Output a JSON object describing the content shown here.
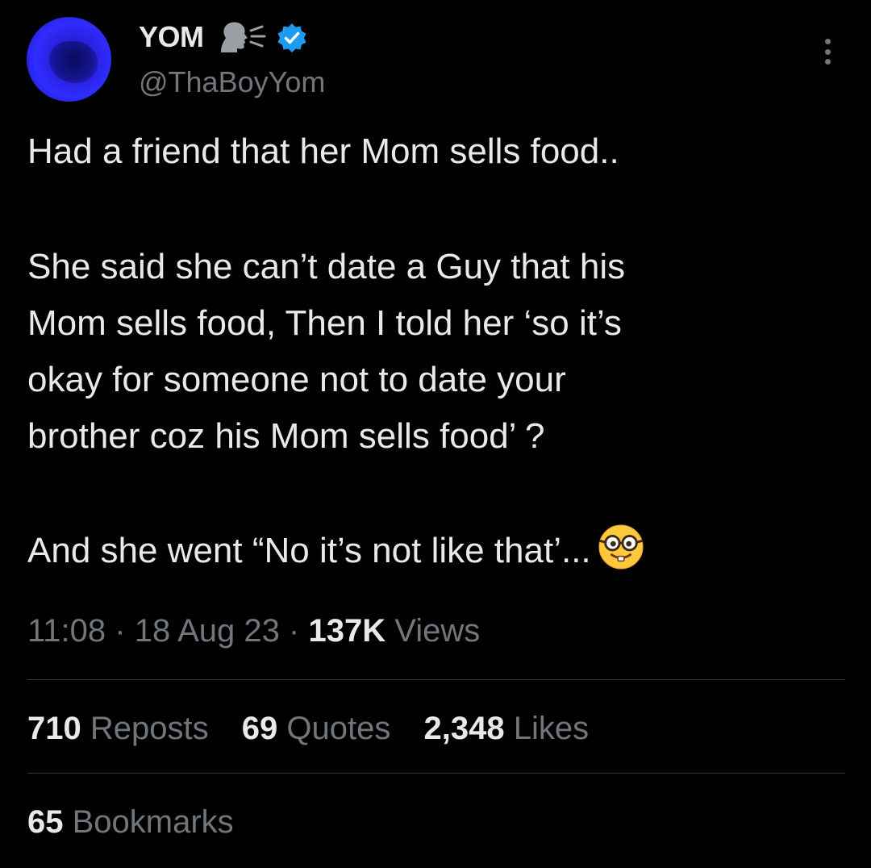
{
  "author": {
    "display_name": "YOM",
    "handle": "@ThaBoyYom",
    "verified": true,
    "name_emoji": "speaking-head-icon",
    "avatar_color": "#2f2cff"
  },
  "tweet": {
    "line1": "Had a friend that her Mom sells food..",
    "para2": "She said she can’t date a Guy that his\nMom sells food, Then I told her ‘so it’s\nokay for someone not to date your\nbrother coz his Mom sells food’ ?",
    "para3": "And she went “No it’s not like that’...",
    "trailing_emoji": "nerd-face-icon"
  },
  "meta": {
    "time": "11:08",
    "separator": "·",
    "date": "18 Aug 23",
    "views_count": "137K",
    "views_label": "Views"
  },
  "stats": {
    "reposts_count": "710",
    "reposts_label": "Reposts",
    "quotes_count": "69",
    "quotes_label": "Quotes",
    "likes_count": "2,348",
    "likes_label": "Likes",
    "bookmarks_count": "65",
    "bookmarks_label": "Bookmarks"
  },
  "colors": {
    "background": "#000000",
    "text_primary": "#e7e9ea",
    "text_secondary": "#71767b",
    "divider": "#2f3336",
    "verified_blue": "#1d9bf0"
  }
}
